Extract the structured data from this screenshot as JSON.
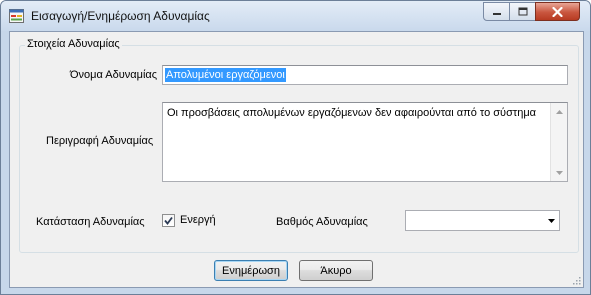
{
  "window": {
    "title": "Εισαγωγή/Ενημέρωση Αδυναμίας",
    "controls": {
      "minimize": "minimize-icon",
      "maximize": "maximize-icon",
      "close": "close-icon"
    }
  },
  "group": {
    "title": "Στοιχεία Αδυναμίας"
  },
  "form": {
    "name_label": "Όνομα Αδυναμίας",
    "name_value": "Απολυμένοι εργαζόμενοι",
    "description_label": "Περιγραφή Αδυναμίας",
    "description_value": "Οι προσβάσεις απολυμένων εργαζόμενων δεν αφαιρούνται από το σύστημα",
    "status_label": "Κατάσταση Αδυναμίας",
    "status_checkbox_label": "Ενεργή",
    "status_checked": true,
    "degree_label": "Βαθμός Αδυναμίας",
    "degree_value": ""
  },
  "buttons": {
    "update": "Ενημέρωση",
    "cancel": "Άκυρο"
  },
  "colors": {
    "selection": "#3399ff",
    "close_button": "#c9563f",
    "window_frame": "#c7d7ea",
    "dialog_background": "#f0f0f0"
  }
}
